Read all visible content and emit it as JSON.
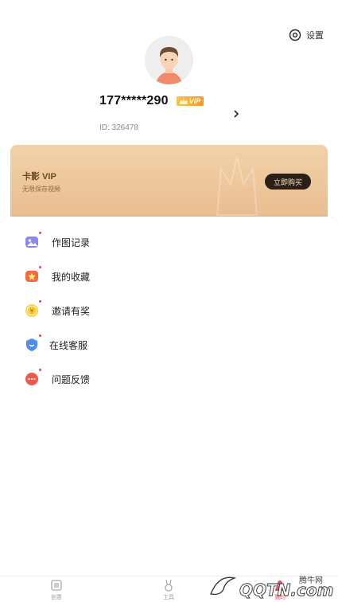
{
  "header": {
    "settings_label": "设置"
  },
  "profile": {
    "phone": "177*****290",
    "vip_badge": "VIP",
    "user_id": "ID: 326478"
  },
  "vip_card": {
    "title": "卡影 VIP",
    "subtitle": "无限保存视频",
    "buy_button": "立即购买"
  },
  "menu": {
    "items": [
      {
        "label": "作图记录",
        "icon": "gallery-icon"
      },
      {
        "label": "我的收藏",
        "icon": "star-icon"
      },
      {
        "label": "邀请有奖",
        "icon": "coin-icon"
      },
      {
        "label": "在线客服",
        "icon": "shield-icon"
      },
      {
        "label": "问题反馈",
        "icon": "chat-icon"
      }
    ]
  },
  "tabbar": {
    "tabs": [
      {
        "label": "创意",
        "icon": "create-icon"
      },
      {
        "label": "工具",
        "icon": "rabbit-icon"
      },
      {
        "label": "我的",
        "icon": "profile-icon"
      }
    ]
  },
  "watermark": {
    "site_name": "腾牛网",
    "logo_text": "QQTN.com"
  },
  "colors": {
    "accent": "#f29b2c",
    "vip_card": "#edc59a",
    "buy_button": "#2b2018"
  }
}
